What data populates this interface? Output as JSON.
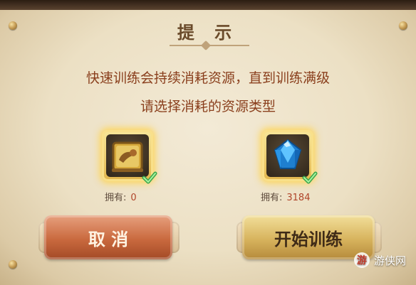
{
  "dialog": {
    "title": "提 示",
    "message_line1": "快速训练会持续消耗资源，直到训练满级",
    "message_line2": "请选择消耗的资源类型"
  },
  "resources": [
    {
      "icon": "book-icon",
      "owned_label": "拥有:",
      "owned_value": "0"
    },
    {
      "icon": "diamond-icon",
      "owned_label": "拥有:",
      "owned_value": "3184"
    }
  ],
  "buttons": {
    "cancel": "取 消",
    "start": "开始训练"
  },
  "watermark": {
    "text": "游侠网",
    "badge": "游"
  },
  "colors": {
    "parchment": "#efe4cc",
    "title": "#6a4a2a",
    "message": "#8a3f1d",
    "cancel_button": "#c9693e",
    "start_button": "#d7b35d",
    "highlight": "#ffd24a",
    "check": "#3aa54b"
  }
}
